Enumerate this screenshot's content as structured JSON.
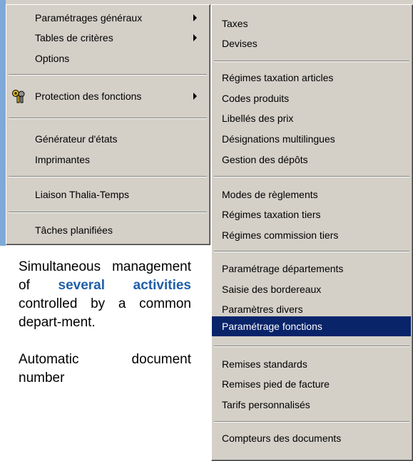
{
  "main_menu": {
    "items": [
      {
        "label": "Paramétrages généraux",
        "has_submenu": true
      },
      {
        "label": "Tables de critères",
        "has_submenu": true
      },
      {
        "label": "Options",
        "has_submenu": false
      },
      {
        "label": "Protection des fonctions",
        "has_submenu": true,
        "icon": "keys-icon"
      },
      {
        "label": "Générateur d'états",
        "has_submenu": false
      },
      {
        "label": "Imprimantes",
        "has_submenu": false
      },
      {
        "label": "Liaison Thalia-Temps",
        "has_submenu": false
      },
      {
        "label": "Tâches planifiées",
        "has_submenu": false
      }
    ]
  },
  "submenu": {
    "items": [
      {
        "label": "Taxes"
      },
      {
        "label": "Devises"
      },
      {
        "label": "Régimes taxation articles"
      },
      {
        "label": "Codes produits"
      },
      {
        "label": "Libellés des prix"
      },
      {
        "label": "Désignations multilingues"
      },
      {
        "label": "Gestion des dépôts"
      },
      {
        "label": "Modes de règlements"
      },
      {
        "label": "Régimes taxation tiers"
      },
      {
        "label": "Régimes commission tiers"
      },
      {
        "label": "Paramétrage départements"
      },
      {
        "label": "Saisie des bordereaux"
      },
      {
        "label": "Paramètres divers"
      },
      {
        "label": "Paramétrage fonctions",
        "highlighted": true
      },
      {
        "label": "Remises standards"
      },
      {
        "label": "Remises pied de facture"
      },
      {
        "label": "Tarifs personnalisés"
      },
      {
        "label": "Compteurs des documents"
      }
    ]
  },
  "description": {
    "para1_before": "Simultaneous management of ",
    "para1_bold": "several activities",
    "para1_after": " controlled by a common depart-ment.",
    "para2": "Automatic document number"
  },
  "colors": {
    "menu_bg": "#d4d0c8",
    "highlight_bg": "#0a246a",
    "highlight_text": "#ffffff",
    "accent_text": "#1f5fa8"
  }
}
